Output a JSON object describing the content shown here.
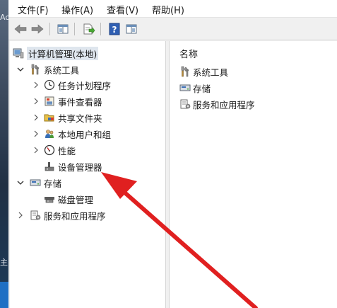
{
  "desktop": {
    "fragment_top": "Ac",
    "fragment_bottom": "主"
  },
  "menu": [
    {
      "label": "文件(F)"
    },
    {
      "label": "操作(A)"
    },
    {
      "label": "查看(V)"
    },
    {
      "label": "帮助(H)"
    }
  ],
  "toolbar": [
    {
      "icon": "back-arrow-icon"
    },
    {
      "icon": "forward-arrow-icon"
    },
    {
      "icon": "show-hide-console-tree-icon"
    },
    {
      "icon": "export-list-icon"
    },
    {
      "icon": "help-icon"
    },
    {
      "icon": "show-hide-action-pane-icon"
    }
  ],
  "tree": {
    "root": {
      "label": "计算机管理(本地)"
    },
    "system_tools": {
      "label": "系统工具",
      "children": [
        {
          "label": "任务计划程序"
        },
        {
          "label": "事件查看器"
        },
        {
          "label": "共享文件夹"
        },
        {
          "label": "本地用户和组"
        },
        {
          "label": "性能"
        },
        {
          "label": "设备管理器"
        }
      ]
    },
    "storage": {
      "label": "存储",
      "children": [
        {
          "label": "磁盘管理"
        }
      ]
    },
    "services": {
      "label": "服务和应用程序"
    }
  },
  "content": {
    "column_header": "名称",
    "items": [
      {
        "label": "系统工具"
      },
      {
        "label": "存储"
      },
      {
        "label": "服务和应用程序"
      }
    ]
  },
  "colors": {
    "annotation_arrow": "#e02020",
    "selection": "#dfe6ee"
  }
}
